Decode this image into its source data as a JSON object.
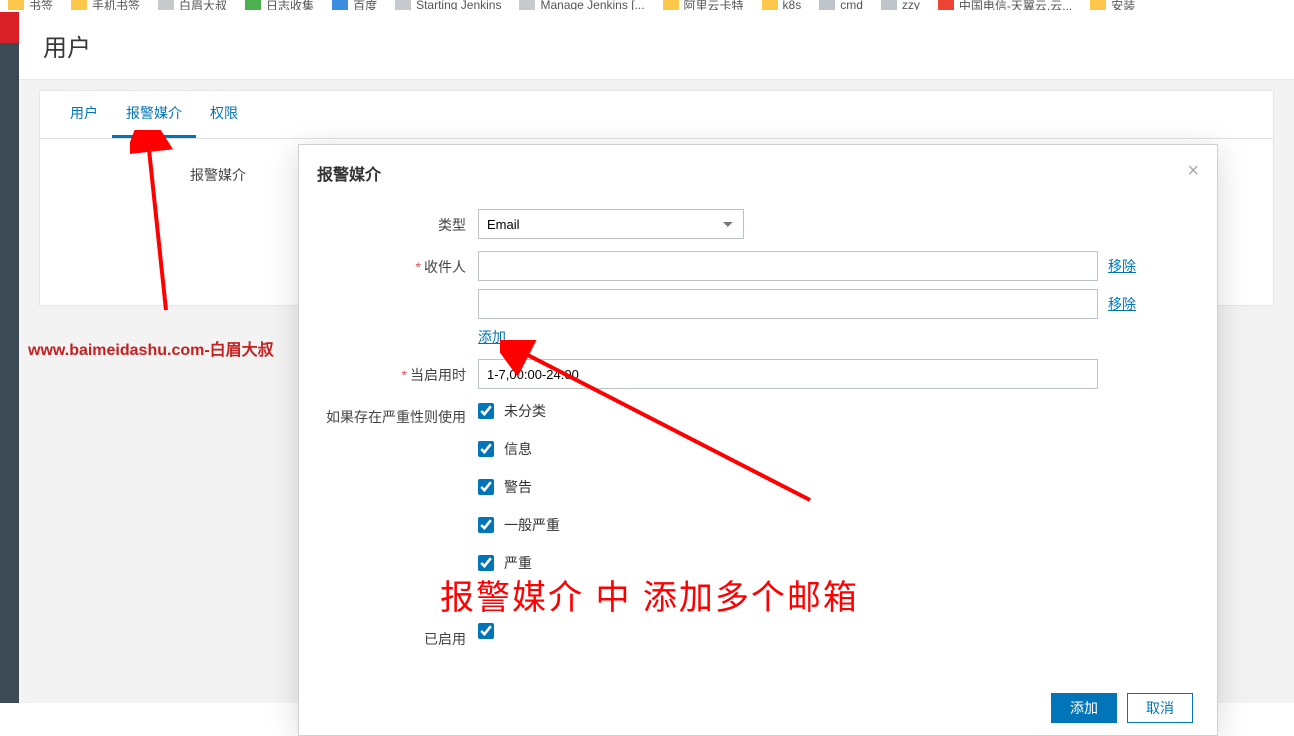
{
  "bookmarks": [
    {
      "label": "书签",
      "iconClass": "ico-folder"
    },
    {
      "label": "手机书签",
      "iconClass": "ico-folder"
    },
    {
      "label": "白眉大叔",
      "iconClass": "ico-person"
    },
    {
      "label": "日志收集",
      "iconClass": "ico-green"
    },
    {
      "label": "百度",
      "iconClass": "ico-blue"
    },
    {
      "label": "Starting Jenkins",
      "iconClass": "ico-person"
    },
    {
      "label": "Manage Jenkins [...",
      "iconClass": "ico-person"
    },
    {
      "label": "阿里云卡特",
      "iconClass": "ico-folder"
    },
    {
      "label": "k8s",
      "iconClass": "ico-folder"
    },
    {
      "label": "cmd",
      "iconClass": "ico-gray"
    },
    {
      "label": "zzy",
      "iconClass": "ico-gray"
    },
    {
      "label": "中国电信-天翼云,云...",
      "iconClass": "ico-red"
    },
    {
      "label": "安装",
      "iconClass": "ico-folder"
    }
  ],
  "page": {
    "title": "用户"
  },
  "tabs": {
    "user": "用户",
    "media": "报警媒介",
    "perm": "权限"
  },
  "content": {
    "media_label": "报警媒介"
  },
  "watermark": "www.baimeidashu.com-白眉大叔",
  "modal": {
    "title": "报警媒介",
    "labels": {
      "type": "类型",
      "recipient": "收件人",
      "remove": "移除",
      "add": "添加",
      "when_enabled": "当启用时",
      "use_if_severity": "如果存在严重性则使用",
      "enabled": "已启用"
    },
    "type_value": "Email",
    "recipient1": "",
    "recipient2": "",
    "when_enabled_value": "1-7,00:00-24:00",
    "severities": {
      "not_classified": "未分类",
      "information": "信息",
      "warning": "警告",
      "average": "一般严重",
      "high": "严重"
    },
    "buttons": {
      "add": "添加",
      "cancel": "取消"
    }
  },
  "annotation": {
    "text": "报警媒介 中 添加多个邮箱"
  }
}
